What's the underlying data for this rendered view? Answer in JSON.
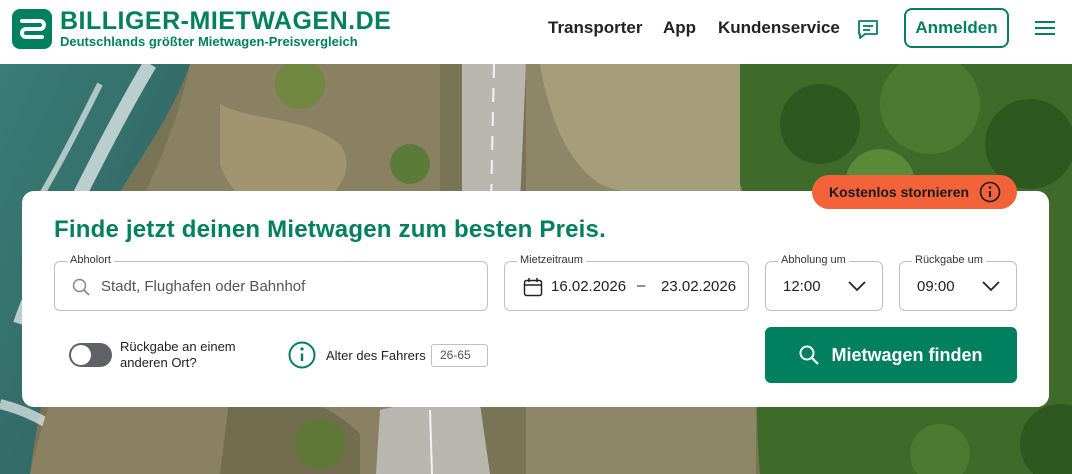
{
  "brand": {
    "name": "BILLIGER-MIETWAGEN.DE",
    "tagline": "Deutschlands größter Mietwagen-Preisvergleich",
    "color": "#00805e"
  },
  "nav": {
    "items": [
      "Transporter",
      "App",
      "Kundenservice"
    ],
    "login_label": "Anmelden",
    "icons": [
      "chat-icon",
      "menu-icon"
    ]
  },
  "badge": {
    "label": "Kostenlos stornieren",
    "color": "#f4623a"
  },
  "search": {
    "headline": "Finde jetzt deinen Mietwagen zum besten Preis.",
    "pickup_label": "Abholort",
    "pickup_placeholder": "Stadt, Flughafen oder Bahnhof",
    "period_label": "Mietzeitraum",
    "date_from": "16.02.2026",
    "date_separator": "–",
    "date_to": "23.02.2026",
    "pickup_time_label": "Abholung um",
    "pickup_time": "12:00",
    "return_time_label": "Rückgabe um",
    "return_time": "09:00",
    "different_return_label": "Rückgabe an einem anderen Ort?",
    "different_return_on": false,
    "driver_age_label": "Alter des Fahrers",
    "driver_age_value": "26-65",
    "submit_label": "Mietwagen finden"
  }
}
